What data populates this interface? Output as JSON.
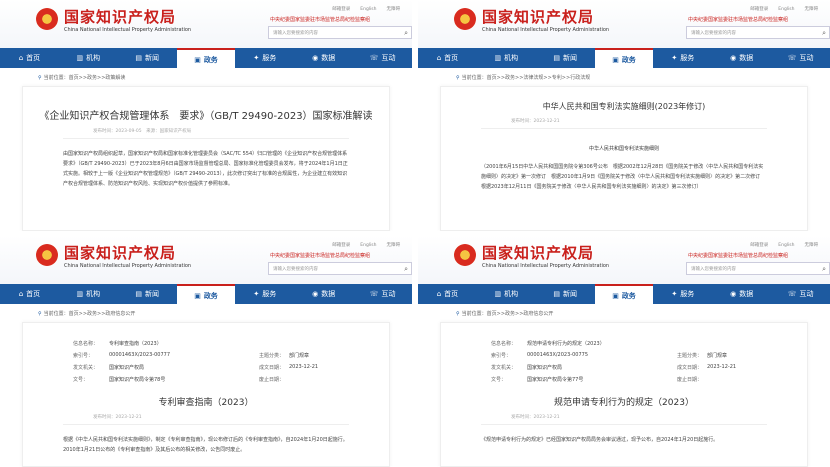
{
  "site": {
    "name_cn": "国家知识产权局",
    "name_en_short": "China National Intellectual Property Administration",
    "name_en_long": "China National Intellectual Property Administration",
    "links": [
      "邮箱登录",
      "English",
      "无障碍"
    ],
    "promo": "中央纪委国家监委驻市场监管总局纪检监察组",
    "search_placeholder": "请输入您要搜索的内容"
  },
  "nav": [
    {
      "icon": "⌂",
      "label": "首页"
    },
    {
      "icon": "▥",
      "label": "机构"
    },
    {
      "icon": "▤",
      "label": "新闻"
    },
    {
      "icon": "▣",
      "label": "政务"
    },
    {
      "icon": "✦",
      "label": "服务"
    },
    {
      "icon": "◉",
      "label": "数据"
    },
    {
      "icon": "☏",
      "label": "互动"
    }
  ],
  "panels": [
    {
      "crumb": "当前位置：首页>>政务>>政策解读",
      "title": "《企业知识产权合规管理体系　要求》（GB/T 29490-2023）国家标准解读",
      "date": "发布时间：2023-09-05　来源：国家知识产权局",
      "body": "由国家知识产权局组织起草，国家知识产权局和国家标准化管理委员会（SAC/TC 554）归口管理的《企业知识产权合规管理体系要求》（GB/T 29490-2023）已于2023年8月6日由国家市场监督管理总局、国家标准化管理委员会发布，将于2024年1月1日正式实施。相较于上一版《企业知识产权管理规范》（GB/T 29490-2013），此次修订突出了标准的合规属性，为企业建立有效知识产权合规管理体系、防范知识产权风险、实现知识产权价值提供了参照标准。"
    },
    {
      "crumb": "当前位置：首页>>政务>>法律法规>>专利>>行政法规",
      "title": "中华人民共和国专利法实施细则(2023年修订)",
      "date": "发布时间：2023-12-21",
      "subtitle": "中华人民共和国专利法实施细则",
      "body": "（2001年6月15日中华人民共和国国务院令第306号公布　根据2002年12月28日《国务院关于修改〈中华人民共和国专利法实施细则〉的决定》第一次修订　根据2010年1月9日《国务院关于修改〈中华人民共和国专利法实施细则〉的决定》第二次修订　根据2023年12月11日《国务院关于修改〈中华人民共和国专利法实施细则〉的决定》第三次修订）"
    },
    {
      "crumb": "当前位置：首页>>政务>>政府信息公开",
      "meta": [
        [
          "信息名称：",
          "专利审查指南（2023）",
          "",
          ""
        ],
        [
          "索引号：",
          "00001463X/2023-00777",
          "主题分类：",
          "部门规章"
        ],
        [
          "发文机关：",
          "国家知识产权局",
          "成文日期：",
          "2023-12-21"
        ],
        [
          "文号：",
          "国家知识产权局令第78号",
          "废止日期：",
          ""
        ]
      ],
      "title": "专利审查指南（2023）",
      "date": "发布时间：2023-12-21",
      "body": "根据《中华人民共和国专利法实施细则》，制定《专利审查指南》，现公布修订后的《专利审查指南》，自2024年1月20日起施行。2010年1月21日公布的《专利审查指南》及其后公布的相关修改，公告同时废止。",
      "body_link": "《专利审查指南》"
    },
    {
      "crumb": "当前位置：首页>>政务>>政府信息公开",
      "meta": [
        [
          "信息名称：",
          "规范申请专利行为的规定（2023）",
          "",
          ""
        ],
        [
          "索引号：",
          "00001463X/2023-00775",
          "主题分类：",
          "部门规章"
        ],
        [
          "发文机关：",
          "国家知识产权局",
          "成文日期：",
          "2023-12-21"
        ],
        [
          "文号：",
          "国家知识产权局令第77号",
          "废止日期：",
          ""
        ]
      ],
      "title": "规范申请专利行为的规定（2023）",
      "date": "发布时间：2023-12-21",
      "body": "《规范申请专利行为的规定》已经国家知识产权局局务会审议通过，现予公布，自2024年1月20日起施行。",
      "body_link": "《规范申请专利行为的规定》"
    }
  ]
}
